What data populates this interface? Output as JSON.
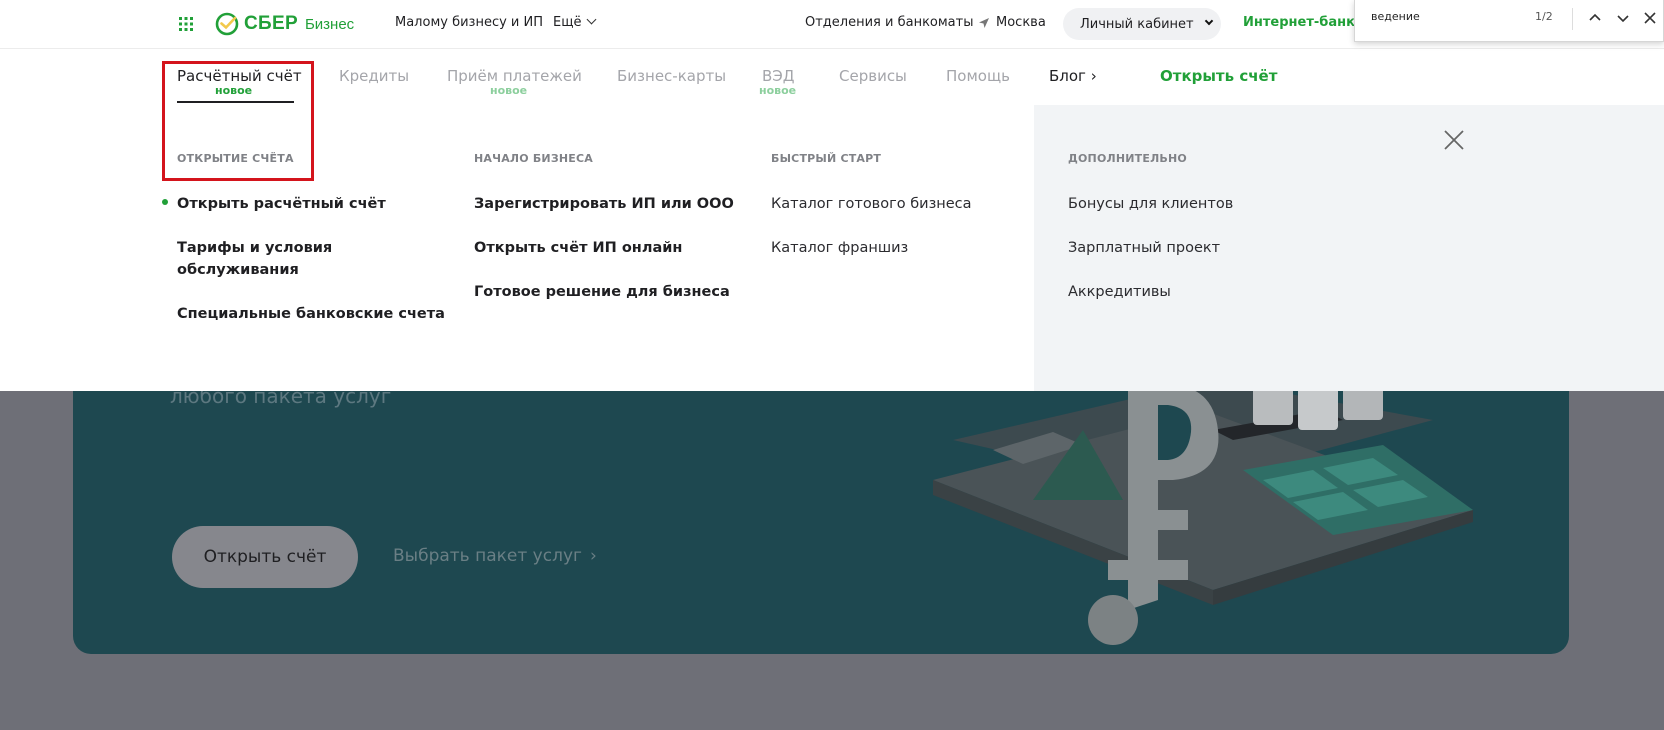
{
  "header": {
    "logo_text": "СБЕР",
    "logo_sub": "Бизнес",
    "links": [
      "Малому бизнесу и ИП",
      "Отделения и банкоматы"
    ],
    "more_label": "Ещё",
    "location": "Москва",
    "cabinet_label": "Личный кабинет",
    "internet_bank": "Интернет-банк Сб"
  },
  "find_bar": {
    "query": "ведение",
    "count": "1/2"
  },
  "subnav": {
    "items": [
      {
        "label": "Расчётный счёт",
        "badge": "новое"
      },
      {
        "label": "Кредиты"
      },
      {
        "label": "Приём платежей",
        "badge": "новое"
      },
      {
        "label": "Бизнес-карты"
      },
      {
        "label": "ВЭД",
        "badge": "новое"
      },
      {
        "label": "Сервисы"
      },
      {
        "label": "Помощь"
      },
      {
        "label": "Блог ›"
      }
    ],
    "cta": "Открыть счёт"
  },
  "menu": {
    "columns": [
      {
        "heading": "ОТКРЫТИЕ СЧЁТА",
        "items": [
          "Открыть расчётный счёт",
          "Тарифы и условия обслуживания",
          "Специальные банковские счета"
        ]
      },
      {
        "heading": "НАЧАЛО БИЗНЕСА",
        "items": [
          "Зарегистрировать ИП или ООО",
          "Открыть счёт ИП онлайн",
          "Готовое решение для бизнеса"
        ]
      },
      {
        "heading": "БЫСТРЫЙ СТАРТ",
        "items": [
          "Каталог готового бизнеса",
          "Каталог франшиз"
        ]
      },
      {
        "heading": "ДОПОЛНИТЕЛЬНО",
        "items": [
          "Бонусы для клиентов",
          "Зарплатный проект",
          "Аккредитивы"
        ]
      }
    ]
  },
  "hero": {
    "subtitle": "любого пакета услуг",
    "open_button": "Открыть счёт",
    "package_link": "Выбрать пакет услуг"
  },
  "colors": {
    "brand_green": "#21a038",
    "highlight_red": "#d4141c",
    "hero_bg": "#1e4850"
  }
}
